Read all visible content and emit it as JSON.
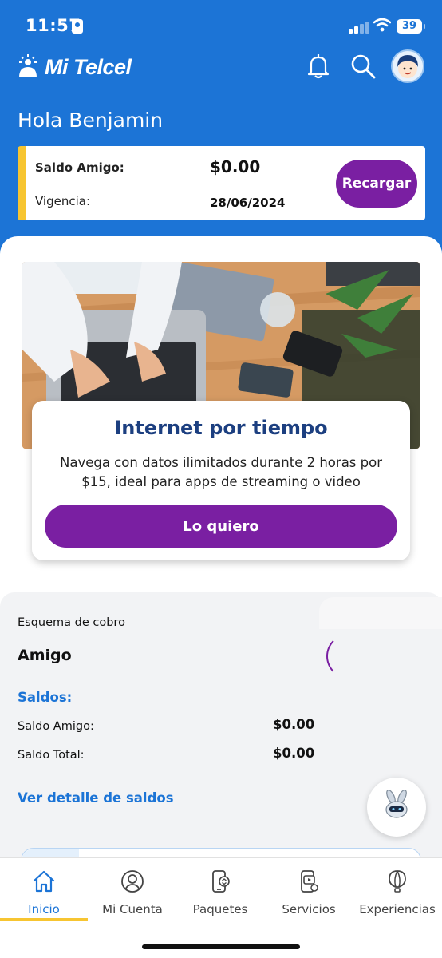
{
  "status_bar": {
    "time": "11:57",
    "battery": "39"
  },
  "header": {
    "logo_text": "Mi Telcel",
    "greeting": "Hola Benjamin"
  },
  "balance_card": {
    "saldo_label": "Saldo Amigo:",
    "saldo_value": "$0.00",
    "vigencia_label": "Vigencia:",
    "vigencia_value": "28/06/2024",
    "recharge_button": "Recargar"
  },
  "promo": {
    "title": "Internet por tiempo",
    "description": "Navega con datos ilimitados durante 2 horas por $15, ideal para apps de streaming o video",
    "button": "Lo quiero"
  },
  "cobro": {
    "scheme_label": "Esquema de cobro",
    "scheme_value": "Amigo",
    "saldos_heading": "Saldos:",
    "rows": [
      {
        "label": "Saldo Amigo:",
        "value": "$0.00"
      },
      {
        "label": "Saldo Total:",
        "value": "$0.00"
      }
    ],
    "detail_link": "Ver detalle de saldos"
  },
  "tabs": [
    {
      "label": "Inicio",
      "icon": "home-icon",
      "active": true
    },
    {
      "label": "Mi Cuenta",
      "icon": "account-icon",
      "active": false
    },
    {
      "label": "Paquetes",
      "icon": "packages-icon",
      "active": false
    },
    {
      "label": "Servicios",
      "icon": "services-icon",
      "active": false
    },
    {
      "label": "Experiencias",
      "icon": "balloon-icon",
      "active": false
    }
  ],
  "colors": {
    "primary_blue": "#1c74d6",
    "accent_purple": "#7a1fa2",
    "accent_yellow": "#f7c531",
    "title_navy": "#1c3f80"
  }
}
